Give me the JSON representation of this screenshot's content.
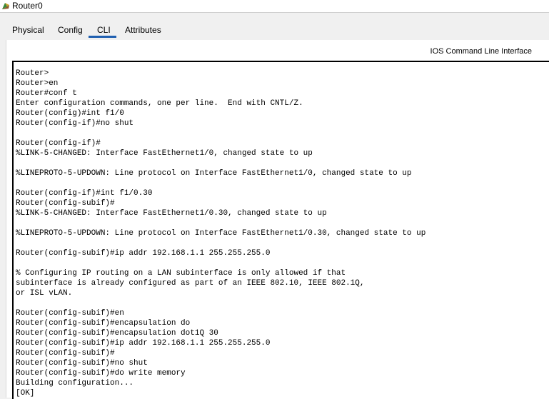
{
  "window": {
    "title": "Router0",
    "icon": "router-icon"
  },
  "tabs": [
    {
      "label": "Physical"
    },
    {
      "label": "Config"
    },
    {
      "label": "CLI",
      "active": true
    },
    {
      "label": "Attributes"
    }
  ],
  "panel": {
    "header": "IOS Command Line Interface"
  },
  "accent_color": "#1f5fb0",
  "cli": {
    "lines": [
      "Router>",
      "Router>en",
      "Router#conf t",
      "Enter configuration commands, one per line.  End with CNTL/Z.",
      "Router(config)#int f1/0",
      "Router(config-if)#no shut",
      "",
      "Router(config-if)#",
      "%LINK-5-CHANGED: Interface FastEthernet1/0, changed state to up",
      "",
      "%LINEPROTO-5-UPDOWN: Line protocol on Interface FastEthernet1/0, changed state to up",
      "",
      "Router(config-if)#int f1/0.30",
      "Router(config-subif)#",
      "%LINK-5-CHANGED: Interface FastEthernet1/0.30, changed state to up",
      "",
      "%LINEPROTO-5-UPDOWN: Line protocol on Interface FastEthernet1/0.30, changed state to up",
      "",
      "Router(config-subif)#ip addr 192.168.1.1 255.255.255.0",
      "",
      "% Configuring IP routing on a LAN subinterface is only allowed if that",
      "subinterface is already configured as part of an IEEE 802.10, IEEE 802.1Q,",
      "or ISL vLAN.",
      "",
      "Router(config-subif)#en",
      "Router(config-subif)#encapsulation do",
      "Router(config-subif)#encapsulation dot1Q 30",
      "Router(config-subif)#ip addr 192.168.1.1 255.255.255.0",
      "Router(config-subif)#",
      "Router(config-subif)#no shut",
      "Router(config-subif)#do write memory",
      "Building configuration...",
      "[OK]"
    ]
  }
}
